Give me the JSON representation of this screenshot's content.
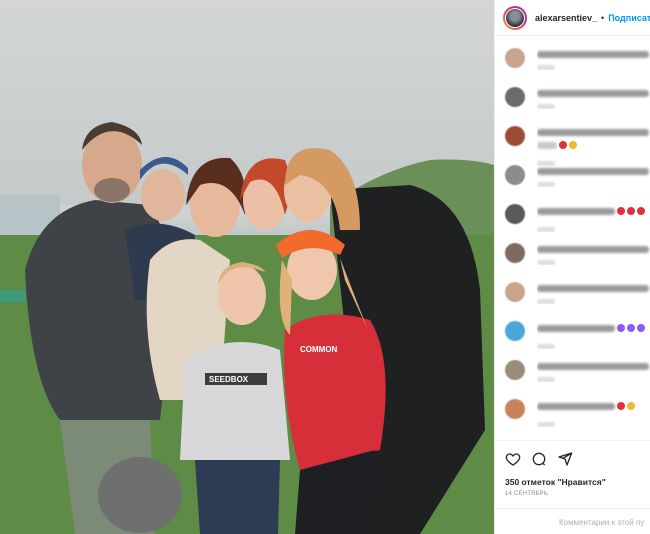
{
  "header": {
    "username": "alexarsentiev_",
    "separator": "•",
    "follow_label": "Подписаться"
  },
  "photo": {
    "caption_on_shirt": "SEEDBOX",
    "caption_on_top": "COMMON"
  },
  "comments": [
    {
      "avatar_color": "#c9a58f",
      "lines": 1,
      "emoji": []
    },
    {
      "avatar_color": "#6e6a67",
      "lines": 1,
      "emoji": []
    },
    {
      "avatar_color": "#9b4a35",
      "lines": 2,
      "emoji": [
        "#e0303a",
        "#f2b632"
      ]
    },
    {
      "avatar_color": "#8c8c8c",
      "lines": 1,
      "emoji": []
    },
    {
      "avatar_color": "#5a5a5a",
      "lines": 1,
      "emoji": [
        "#e0303a",
        "#e0303a",
        "#e0303a"
      ]
    },
    {
      "avatar_color": "#7d6b5f",
      "lines": 1,
      "emoji": []
    },
    {
      "avatar_color": "#c7a48a",
      "lines": 1,
      "emoji": []
    },
    {
      "avatar_color": "#4aa6d8",
      "lines": 1,
      "emoji": [
        "#8b5cf6",
        "#8b5cf6",
        "#8b5cf6"
      ]
    },
    {
      "avatar_color": "#9a8c7a",
      "lines": 1,
      "emoji": []
    },
    {
      "avatar_color": "#c9825b",
      "lines": 1,
      "emoji": [
        "#e0303a",
        "#f2b632"
      ]
    }
  ],
  "actions": {
    "like_icon": "heart-icon",
    "comment_icon": "comment-icon",
    "share_icon": "share-icon"
  },
  "likes_text": "350 отметок \"Нравится\"",
  "date_text": "14 СЕНТЯБРЬ",
  "add_comment_placeholder": "Комментарии к этой пу"
}
